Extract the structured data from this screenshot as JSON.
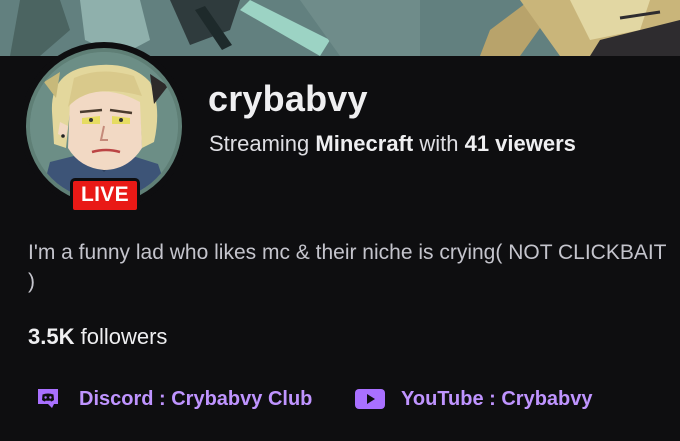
{
  "channel": {
    "name": "crybabvy",
    "live_label": "LIVE"
  },
  "status": {
    "prefix": "Streaming",
    "game": "Minecraft",
    "middle": "with",
    "viewers": "41 viewers"
  },
  "bio": "I'm a funny lad who likes mc & their niche is crying( NOT CLICKBAIT )",
  "followers": {
    "count": "3.5K",
    "label": "followers"
  },
  "links": [
    {
      "label": "Discord : Crybabvy Club",
      "icon": "discord-icon"
    },
    {
      "label": "YouTube : Crybabvy",
      "icon": "youtube-icon"
    }
  ],
  "colors": {
    "background": "#0e0e10",
    "accent": "#bf94ff",
    "live_red": "#e91916",
    "icon_purple": "#a970ff"
  }
}
